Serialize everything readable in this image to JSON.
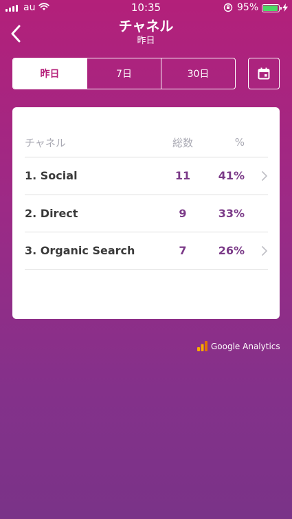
{
  "status_bar": {
    "carrier": "au",
    "time": "10:35",
    "battery_percent": "95%",
    "battery_level": 0.95,
    "battery_color": "#4cd964"
  },
  "header": {
    "title": "チャネル",
    "subtitle": "昨日",
    "back_icon": "chevron-left-icon"
  },
  "range_tabs": [
    {
      "label": "昨日",
      "selected": true
    },
    {
      "label": "7日",
      "selected": false
    },
    {
      "label": "30日",
      "selected": false
    }
  ],
  "calendar_icon": "calendar-icon",
  "table": {
    "headers": {
      "name": "チャネル",
      "total": "総数",
      "percent": "%"
    },
    "rows": [
      {
        "name": "1. Social",
        "total": "11",
        "percent": "41%",
        "has_arrow": true
      },
      {
        "name": "2. Direct",
        "total": "9",
        "percent": "33%",
        "has_arrow": false
      },
      {
        "name": "3. Organic Search",
        "total": "7",
        "percent": "26%",
        "has_arrow": true
      }
    ]
  },
  "footer": {
    "brand": "Google Analytics",
    "brand_icon": "analytics-logo-icon"
  },
  "colors": {
    "gradient_top": "#b3207a",
    "gradient_bottom": "#7a3388",
    "accent": "#b5207a",
    "value_text": "#7b3a88"
  }
}
